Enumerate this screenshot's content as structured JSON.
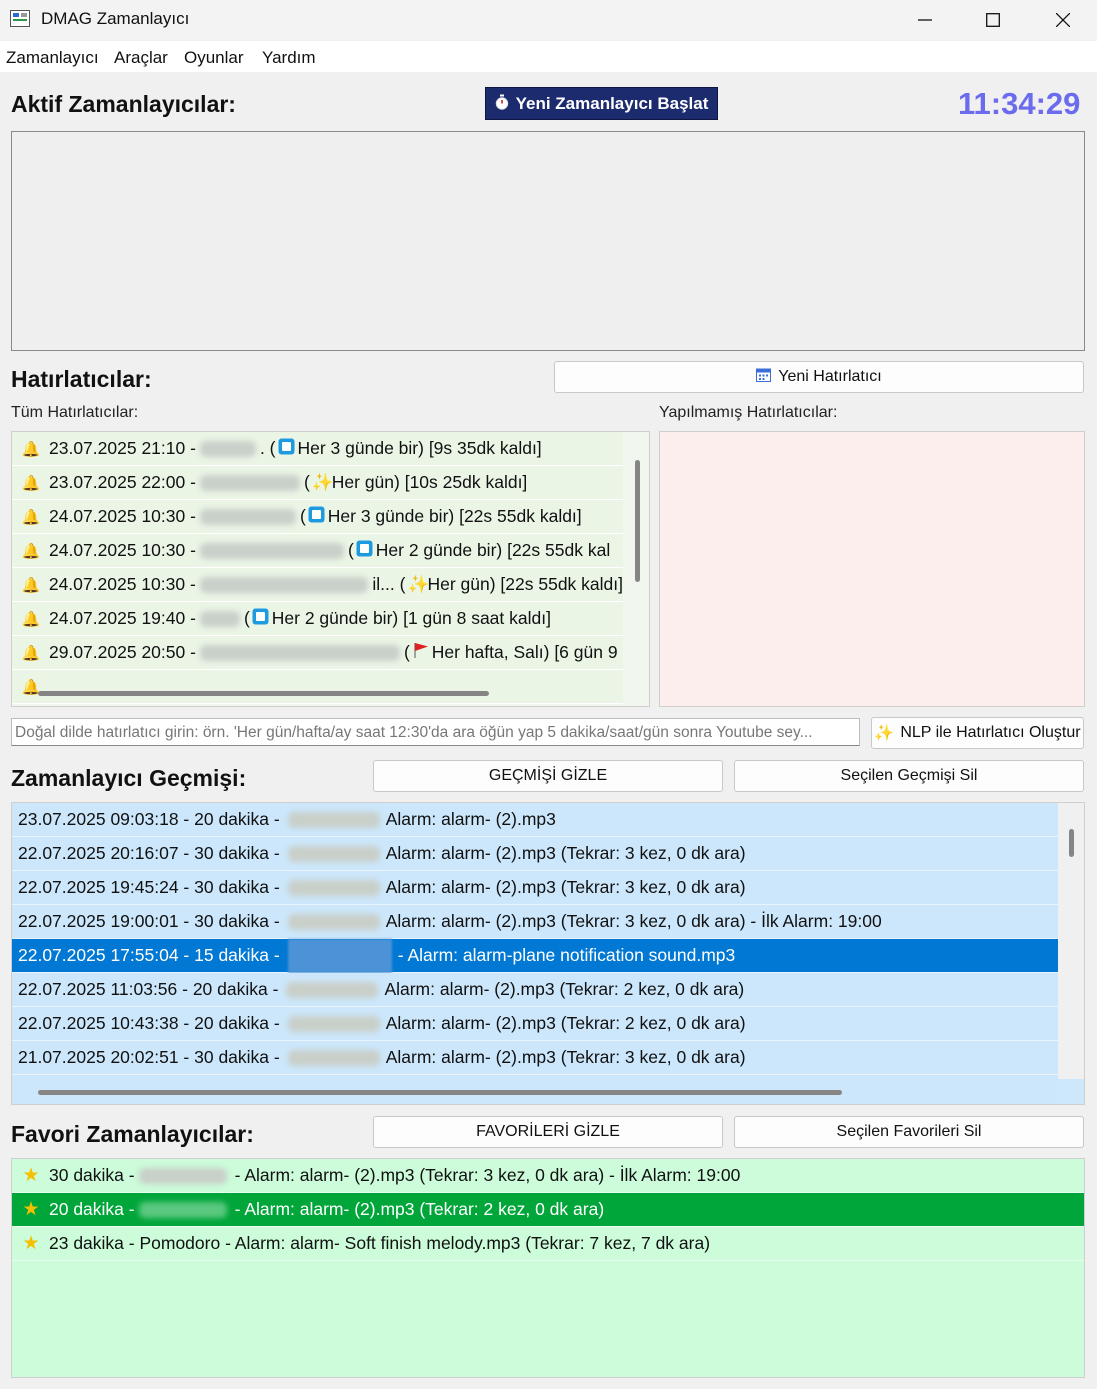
{
  "window": {
    "title": "DMAG Zamanlayıcı",
    "min_icon": "minimize-icon",
    "max_icon": "maximize-icon",
    "close_icon": "close-icon"
  },
  "menu": [
    "Zamanlayıcı",
    "Araçlar",
    "Oyunlar",
    "Yardım"
  ],
  "active": {
    "heading": "Aktif Zamanlayıcılar:",
    "start_button": "Yeni Zamanlayıcı Başlat",
    "start_icon": "stopwatch-icon",
    "clock": "11:34:29",
    "clock_color": "#6b6bee"
  },
  "reminders": {
    "heading": "Hatırlatıcılar:",
    "new_button": "Yeni Hatırlatıcı",
    "new_icon": "calendar-icon",
    "all_label": "Tüm Hatırlatıcılar:",
    "pending_label": "Yapılmamış Hatırlatıcılar:",
    "items": [
      {
        "date": "23.07.2025 21:10 -",
        "mid": ". (",
        "icon": "square-icon",
        "text": "Her 3 günde bir) [9s 35dk kaldı]"
      },
      {
        "date": "23.07.2025 22:00 -",
        "mid": "(",
        "icon": "sparkles-icon",
        "text": "Her gün) [10s 25dk kaldı]"
      },
      {
        "date": "24.07.2025 10:30 -",
        "mid": "(",
        "icon": "square-icon",
        "text": "Her 3 günde bir) [22s 55dk kaldı]"
      },
      {
        "date": "24.07.2025 10:30 -",
        "mid": "(",
        "icon": "square-icon",
        "text": "Her 2 günde bir) [22s 55dk kal"
      },
      {
        "date": "24.07.2025 10:30 -",
        "mid": "il... (",
        "icon": "sparkles-icon",
        "text": "Her gün) [22s 55dk kaldı]"
      },
      {
        "date": "24.07.2025 19:40 -",
        "mid": "(",
        "icon": "square-icon",
        "text": "Her 2 günde bir) [1 gün 8 saat kaldı]"
      },
      {
        "date": "29.07.2025 20:50 -",
        "mid": "(",
        "icon": "flag-icon",
        "text": "Her hafta, Salı) [6 gün 9"
      }
    ],
    "nlp_placeholder": "Doğal dilde hatırlatıcı girin: örn. 'Her gün/hafta/ay saat 12:30'da ara öğün yap   5 dakika/saat/gün sonra Youtube sey...",
    "nlp_button": "NLP ile Hatırlatıcı Oluştur",
    "nlp_icon": "sparkles-icon"
  },
  "history": {
    "heading": "Zamanlayıcı Geçmişi:",
    "hide_button": "GEÇMİŞİ GİZLE",
    "delete_button": "Seçilen Geçmişi Sil",
    "items": [
      {
        "prefix": "23.07.2025 09:03:18 - 20 dakika -",
        "suffix": "Alarm: alarm- (2).mp3"
      },
      {
        "prefix": "22.07.2025 20:16:07 - 30 dakika -",
        "suffix": "Alarm: alarm- (2).mp3 (Tekrar: 3 kez, 0 dk ara)"
      },
      {
        "prefix": "22.07.2025 19:45:24 - 30 dakika -",
        "suffix": "Alarm: alarm- (2).mp3 (Tekrar: 3 kez, 0 dk ara)"
      },
      {
        "prefix": "22.07.2025 19:00:01 - 30 dakika -",
        "suffix": "Alarm: alarm- (2).mp3 (Tekrar: 3 kez, 0 dk ara) - İlk Alarm: 19:00"
      },
      {
        "prefix": "22.07.2025 17:55:04 - 15 dakika -",
        "suffix": "- Alarm: alarm-plane notification sound.mp3",
        "selected": true
      },
      {
        "prefix": "22.07.2025 11:03:56 - 20 dakika -",
        "suffix": "Alarm: alarm- (2).mp3 (Tekrar: 2 kez, 0 dk ara)"
      },
      {
        "prefix": "22.07.2025 10:43:38 - 20 dakika -",
        "suffix": "Alarm: alarm- (2).mp3 (Tekrar: 2 kez, 0 dk ara)"
      },
      {
        "prefix": "21.07.2025 20:02:51 - 30 dakika -",
        "suffix": "Alarm: alarm- (2).mp3 (Tekrar: 3 kez, 0 dk ara)"
      }
    ],
    "selected_color": "#0078d4"
  },
  "favorites": {
    "heading": "Favori Zamanlayıcılar:",
    "hide_button": "FAVORİLERİ GİZLE",
    "delete_button": "Seçilen Favorileri Sil",
    "items": [
      {
        "prefix": "30 dakika - ",
        "blur": true,
        "suffix": "- Alarm: alarm- (2).mp3 (Tekrar: 3 kez, 0 dk ara) - İlk Alarm: 19:00"
      },
      {
        "prefix": "20 dakika - ",
        "blur": true,
        "suffix": "- Alarm: alarm- (2).mp3 (Tekrar: 2 kez, 0 dk ara)",
        "selected": true
      },
      {
        "prefix": "23 dakika - Pomodoro - Alarm: alarm- Soft finish melody.mp3 (Tekrar: 7 kez, 7 dk ara)",
        "blur": false,
        "suffix": ""
      }
    ],
    "item_icon": "star-icon",
    "selected_color": "#00a63a"
  }
}
